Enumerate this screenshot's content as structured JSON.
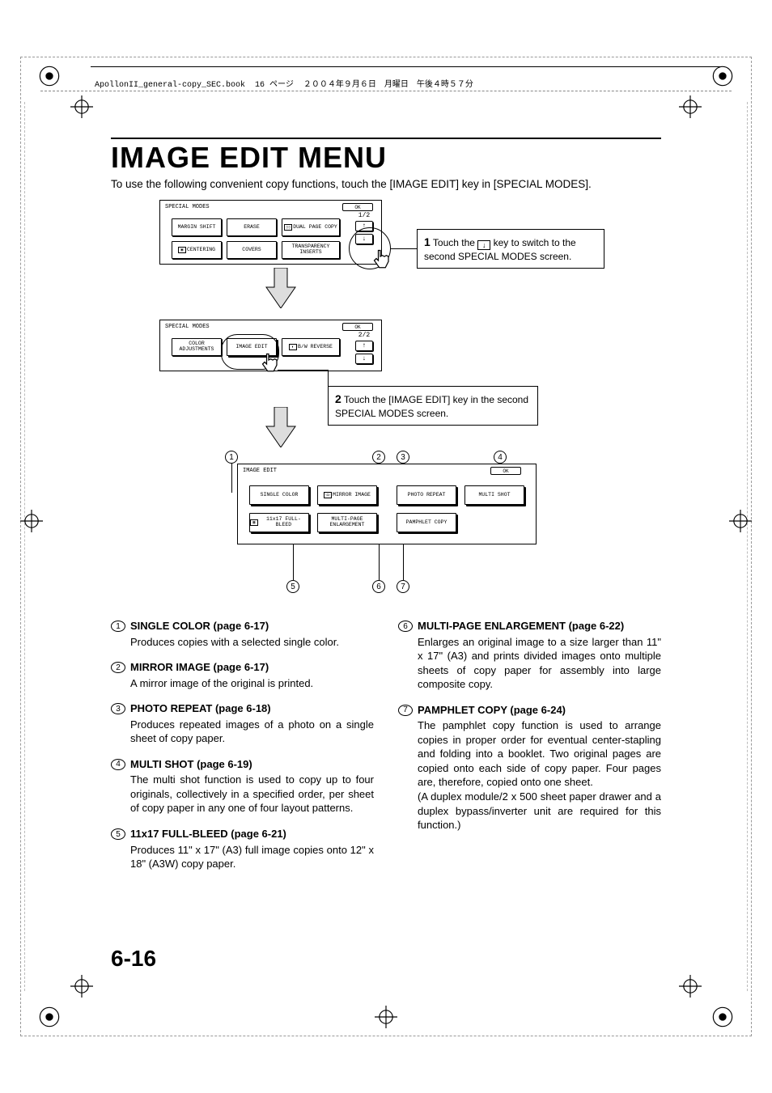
{
  "header_line": "ApollonII_general-copy_SEC.book  16 ページ  ２００４年９月６日　月曜日　午後４時５７分",
  "title": "IMAGE EDIT MENU",
  "intro": "To use the following convenient copy functions, touch the [IMAGE EDIT] key in [SPECIAL MODES].",
  "panel1": {
    "title": "SPECIAL MODES",
    "ok": "OK",
    "frac": "1/2",
    "buttons": [
      "MARGIN SHIFT",
      "ERASE",
      "DUAL PAGE COPY",
      "CENTERING",
      "COVERS",
      "TRANSPARENCY INSERTS"
    ]
  },
  "panel2": {
    "title": "SPECIAL MODES",
    "ok": "OK",
    "frac": "2/2",
    "buttons": [
      "COLOR ADJUSTMENTS",
      "IMAGE EDIT",
      "B/W REVERSE"
    ]
  },
  "panel3": {
    "title": "IMAGE EDIT",
    "ok": "OK",
    "buttons": [
      "SINGLE COLOR",
      "MIRROR IMAGE",
      "PHOTO REPEAT",
      "MULTI SHOT",
      "11x17 FULL-BLEED",
      "MULTI-PAGE ENLARGEMENT",
      "PAMPHLET COPY"
    ]
  },
  "callout1": {
    "num": "1",
    "text_a": "Touch the ",
    "text_b": " key to switch to the second SPECIAL MODES screen."
  },
  "callout2": {
    "num": "2",
    "text": "Touch the [IMAGE EDIT] key in the second SPECIAL MODES screen."
  },
  "items": [
    {
      "n": "1",
      "title": "SINGLE COLOR (page 6-17)",
      "body": "Produces copies with a selected single color."
    },
    {
      "n": "2",
      "title": "MIRROR IMAGE (page 6-17)",
      "body": "A mirror image of the original is printed."
    },
    {
      "n": "3",
      "title": "PHOTO REPEAT (page 6-18)",
      "body": "Produces repeated images of a photo on a single sheet of copy paper."
    },
    {
      "n": "4",
      "title": "MULTI SHOT (page 6-19)",
      "body": "The multi shot function is used to copy up to four originals, collectively in a specified order, per sheet of copy paper in any one of four layout patterns."
    },
    {
      "n": "5",
      "title": "11x17 FULL-BLEED (page 6-21)",
      "body": "Produces 11\" x 17\" (A3) full image copies onto 12\" x 18\" (A3W) copy paper."
    },
    {
      "n": "6",
      "title": "MULTI-PAGE ENLARGEMENT (page 6-22)",
      "body": "Enlarges an original image to a size larger than 11\" x 17\" (A3) and prints divided images onto multiple sheets of copy paper for assembly into large composite copy."
    },
    {
      "n": "7",
      "title": "PAMPHLET COPY (page 6-24)",
      "body": "The pamphlet copy function is used to arrange copies in proper order for eventual center-stapling and folding into a booklet. Two original pages are copied onto each side of copy paper. Four pages are, therefore, copied onto one sheet.\n(A duplex module/2 x 500 sheet paper drawer and a duplex bypass/inverter unit are required for this function.)"
    }
  ],
  "page_num": "6-16"
}
